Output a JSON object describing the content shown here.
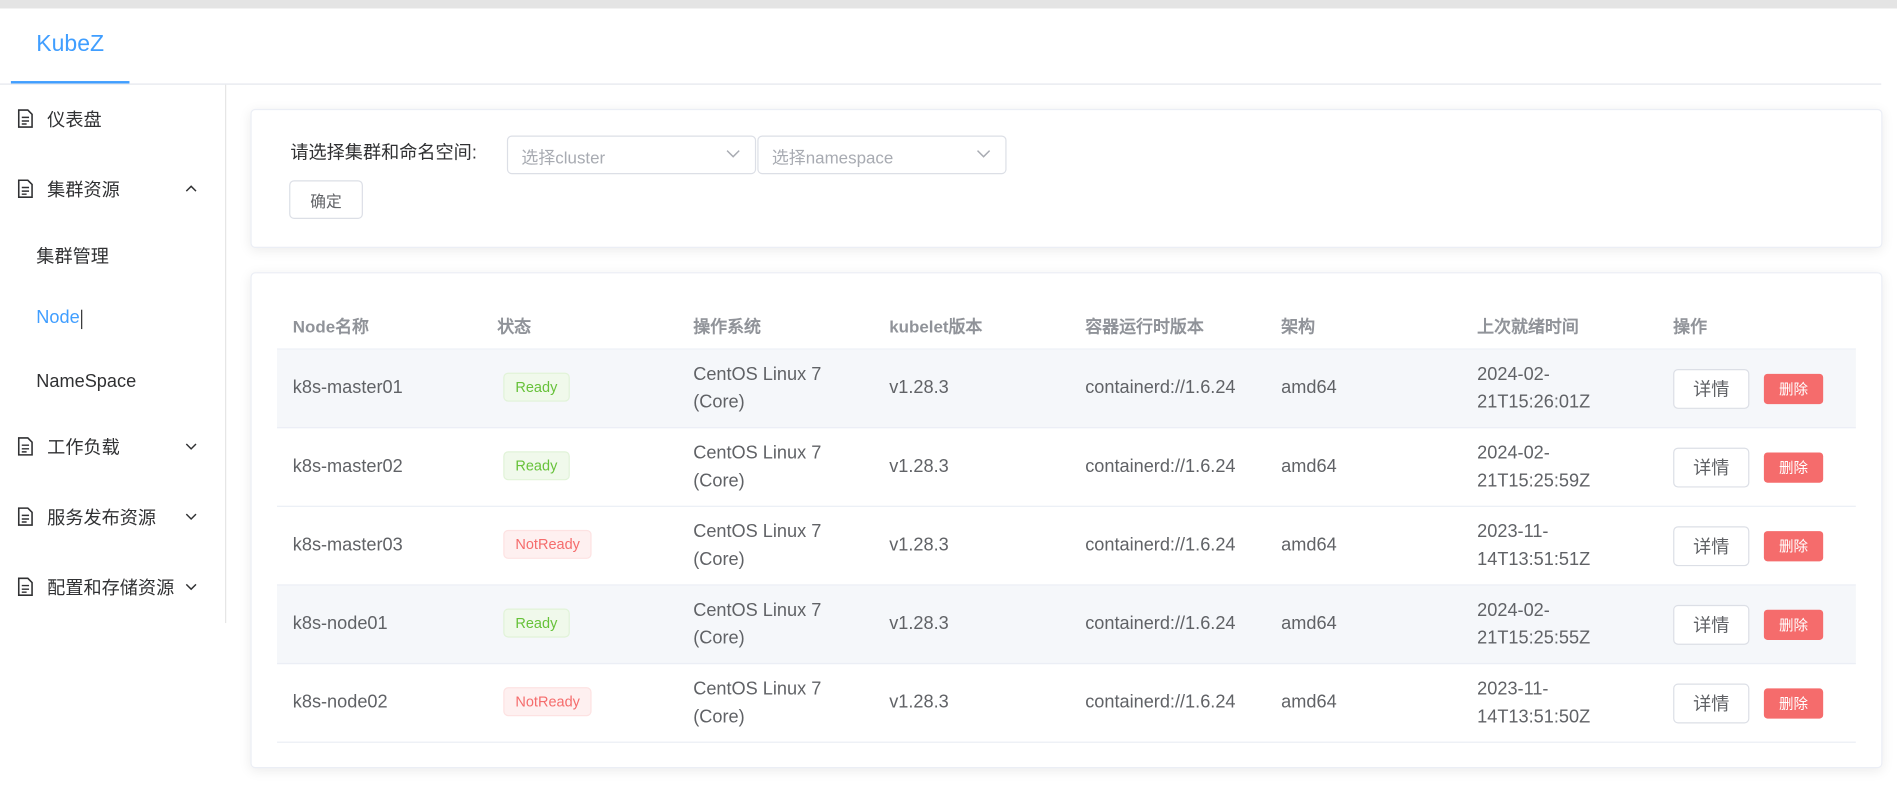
{
  "app": {
    "logo": "KubeZ"
  },
  "sidebar": {
    "dashboard": "仪表盘",
    "cluster_resources": "集群资源",
    "cluster_sub": [
      "集群管理",
      "Node",
      "NameSpace"
    ],
    "workloads": "工作负载",
    "service_publish": "服务发布资源",
    "config_storage": "配置和存储资源"
  },
  "filter": {
    "label": "请选择集群和命名空间:",
    "cluster_placeholder": "选择cluster",
    "namespace_placeholder": "选择namespace",
    "confirm": "确定"
  },
  "table": {
    "headers": [
      "Node名称",
      "状态",
      "操作系统",
      "kubelet版本",
      "容器运行时版本",
      "架构",
      "上次就绪时间",
      "操作"
    ],
    "rows": [
      {
        "name": "k8s-master01",
        "status": "Ready",
        "os": [
          "CentOS Linux 7",
          "(Core)"
        ],
        "kubelet": "v1.28.3",
        "runtime": "containerd://1.6.24",
        "arch": "amd64",
        "ready_time": [
          "2024-02-",
          "21T15:26:01Z"
        ],
        "detail": "详情",
        "delete": "删除"
      },
      {
        "name": "k8s-master02",
        "status": "Ready",
        "os": [
          "CentOS Linux 7",
          "(Core)"
        ],
        "kubelet": "v1.28.3",
        "runtime": "containerd://1.6.24",
        "arch": "amd64",
        "ready_time": [
          "2024-02-",
          "21T15:25:59Z"
        ],
        "detail": "详情",
        "delete": "删除"
      },
      {
        "name": "k8s-master03",
        "status": "NotReady",
        "os": [
          "CentOS Linux 7",
          "(Core)"
        ],
        "kubelet": "v1.28.3",
        "runtime": "containerd://1.6.24",
        "arch": "amd64",
        "ready_time": [
          "2023-11-",
          "14T13:51:51Z"
        ],
        "detail": "详情",
        "delete": "删除"
      },
      {
        "name": "k8s-node01",
        "status": "Ready",
        "os": [
          "CentOS Linux 7",
          "(Core)"
        ],
        "kubelet": "v1.28.3",
        "runtime": "containerd://1.6.24",
        "arch": "amd64",
        "ready_time": [
          "2024-02-",
          "21T15:25:55Z"
        ],
        "detail": "详情",
        "delete": "删除"
      },
      {
        "name": "k8s-node02",
        "status": "NotReady",
        "os": [
          "CentOS Linux 7",
          "(Core)"
        ],
        "kubelet": "v1.28.3",
        "runtime": "containerd://1.6.24",
        "arch": "amd64",
        "ready_time": [
          "2023-11-",
          "14T13:51:50Z"
        ],
        "detail": "详情",
        "delete": "删除"
      }
    ]
  },
  "colors": {
    "primary": "#409eff",
    "success": "#67c23a",
    "danger": "#f56c6c"
  },
  "icons": {
    "menu": "document-icon",
    "expand": "chevron-up-icon",
    "collapse": "chevron-down-icon"
  }
}
